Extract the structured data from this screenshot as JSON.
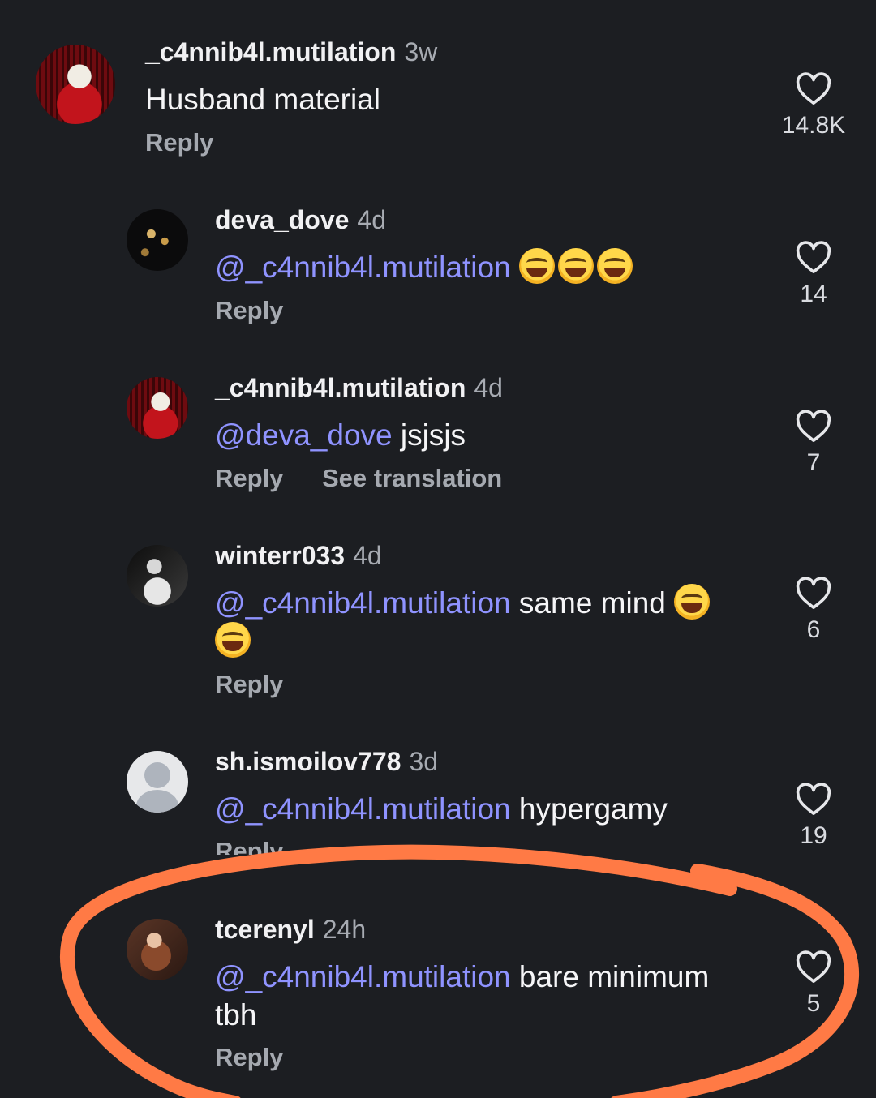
{
  "comments": [
    {
      "username": "_c4nnib4l.mutilation",
      "time": "3w",
      "mention": "",
      "text": "Husband material",
      "reply_label": "Reply",
      "likes": "14.8K",
      "avatar": "red-cat-avatar"
    },
    {
      "username": "deva_dove",
      "time": "4d",
      "mention": "_c4nnib4l.mutilation",
      "text": "",
      "emoji": [
        "😂",
        "😂",
        "😂"
      ],
      "reply_label": "Reply",
      "likes": "14",
      "avatar": "gold-ornaments-avatar"
    },
    {
      "username": "_c4nnib4l.mutilation",
      "time": "4d",
      "mention": "deva_dove",
      "text": "jsjsjs",
      "reply_label": "Reply",
      "translation_label": "See translation",
      "likes": "7",
      "avatar": "red-cat-avatar"
    },
    {
      "username": "winterr033",
      "time": "4d",
      "mention": "_c4nnib4l.mutilation",
      "text": "same mind",
      "emoji": [
        "😂",
        "😂"
      ],
      "reply_label": "Reply",
      "likes": "6",
      "avatar": "bw-portrait-avatar"
    },
    {
      "username": "sh.ismoilov778",
      "time": "3d",
      "mention": "_c4nnib4l.mutilation",
      "text": "hypergamy",
      "reply_label": "Reply",
      "likes": "19",
      "avatar": "default-avatar"
    },
    {
      "username": "tcerenyl",
      "time": "24h",
      "mention": "_c4nnib4l.mutilation",
      "text": "bare minimum",
      "text_line2": "tbh",
      "reply_label": "Reply",
      "likes": "5",
      "avatar": "warm-portrait-avatar"
    }
  ],
  "annotation": {
    "color": "#ff7a45"
  },
  "colors": {
    "background": "#1c1e22",
    "mention": "#8f93ff",
    "muted": "#a5a9b0"
  }
}
